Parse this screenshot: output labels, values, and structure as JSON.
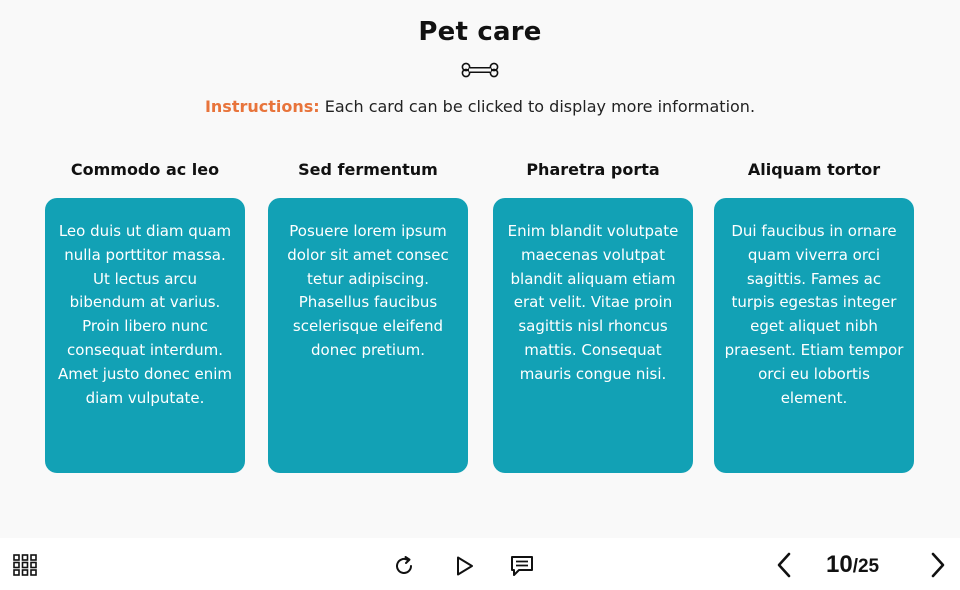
{
  "page": {
    "title": "Pet care",
    "title_icon": "bone-icon",
    "instructions_lead": "Instructions:",
    "instructions_text": " Each card can be clicked to display more information."
  },
  "cards": [
    {
      "heading": "Commodo ac leo",
      "body": "Leo duis ut diam quam nulla porttitor massa. Ut lectus arcu bibendum at varius. Proin libero nunc consequat interdum. Amet justo donec enim diam vulputate."
    },
    {
      "heading": "Sed fermentum",
      "body": "Posuere lorem ipsum dolor sit amet consec tetur adipiscing. Phasellus faucibus scelerisque eleifend donec pretium."
    },
    {
      "heading": "Pharetra porta",
      "body": "Enim blandit volutpate maecenas volutpat blandit aliquam etiam erat velit. Vitae proin sagittis nisl rhoncus mattis. Consequat mauris congue nisi."
    },
    {
      "heading": "Aliquam tortor",
      "body": "Dui faucibus in ornare quam viverra orci sagittis. Fames ac turpis egestas integer eget aliquet nibh praesent. Etiam tempor orci eu lobortis element."
    }
  ],
  "toolbar": {
    "menu_icon": "grid-menu-icon",
    "replay_icon": "replay-icon",
    "play_icon": "play-icon",
    "transcript_icon": "transcript-icon",
    "prev_icon": "chevron-left-icon",
    "next_icon": "chevron-right-icon",
    "current_page": "10",
    "separator": "/",
    "total_pages": "25"
  },
  "colors": {
    "card_bg": "#12a1b5",
    "accent": "#e8743b",
    "stage_bg": "#f9f9f9",
    "toolbar_bg": "#ffffff"
  }
}
